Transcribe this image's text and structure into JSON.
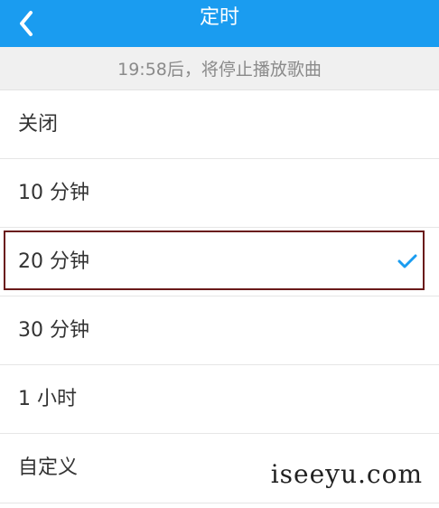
{
  "header": {
    "title": "定时",
    "back_icon": "chevron-left-icon",
    "background_color": "#1a9cf0"
  },
  "status": {
    "text": "19:58后，将停止播放歌曲"
  },
  "options": [
    {
      "label": "关闭",
      "selected": false
    },
    {
      "label": "10 分钟",
      "selected": false
    },
    {
      "label": "20 分钟",
      "selected": true
    },
    {
      "label": "30 分钟",
      "selected": false
    },
    {
      "label": "1 小时",
      "selected": false
    },
    {
      "label": "自定义",
      "selected": false
    }
  ],
  "selection": {
    "check_icon": "checkmark-icon",
    "check_color": "#1a9cf0",
    "highlight_color": "#6a1a1a"
  },
  "watermark": {
    "text": "iseeyu.com"
  }
}
